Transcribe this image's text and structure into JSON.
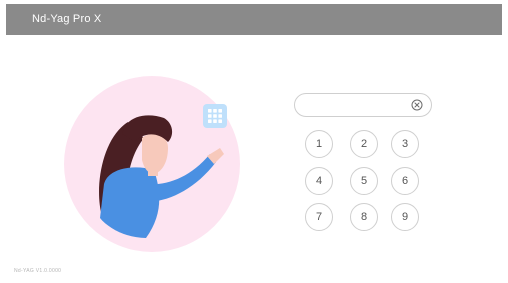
{
  "window": {
    "title": "Nd-Yag Pro X"
  },
  "pin_input": {
    "value": "",
    "placeholder": ""
  },
  "keypad": {
    "keys": [
      {
        "label": "1"
      },
      {
        "label": "2"
      },
      {
        "label": "3"
      },
      {
        "label": "4"
      },
      {
        "label": "5"
      },
      {
        "label": "6"
      },
      {
        "label": "7"
      },
      {
        "label": "8"
      },
      {
        "label": "9"
      }
    ]
  },
  "footer": {
    "version": "Nd-YAG V1.0.0000"
  },
  "icons": {
    "keypad_toggle": "keypad-grid-icon",
    "clear": "clear-circle-icon"
  },
  "colors": {
    "titlebar": "#8a8a8a",
    "illustration_bg": "#fde4f1",
    "keypad_icon_bg": "#bfe0fb",
    "shirt": "#4a90e2",
    "hair": "#4a1f23"
  }
}
